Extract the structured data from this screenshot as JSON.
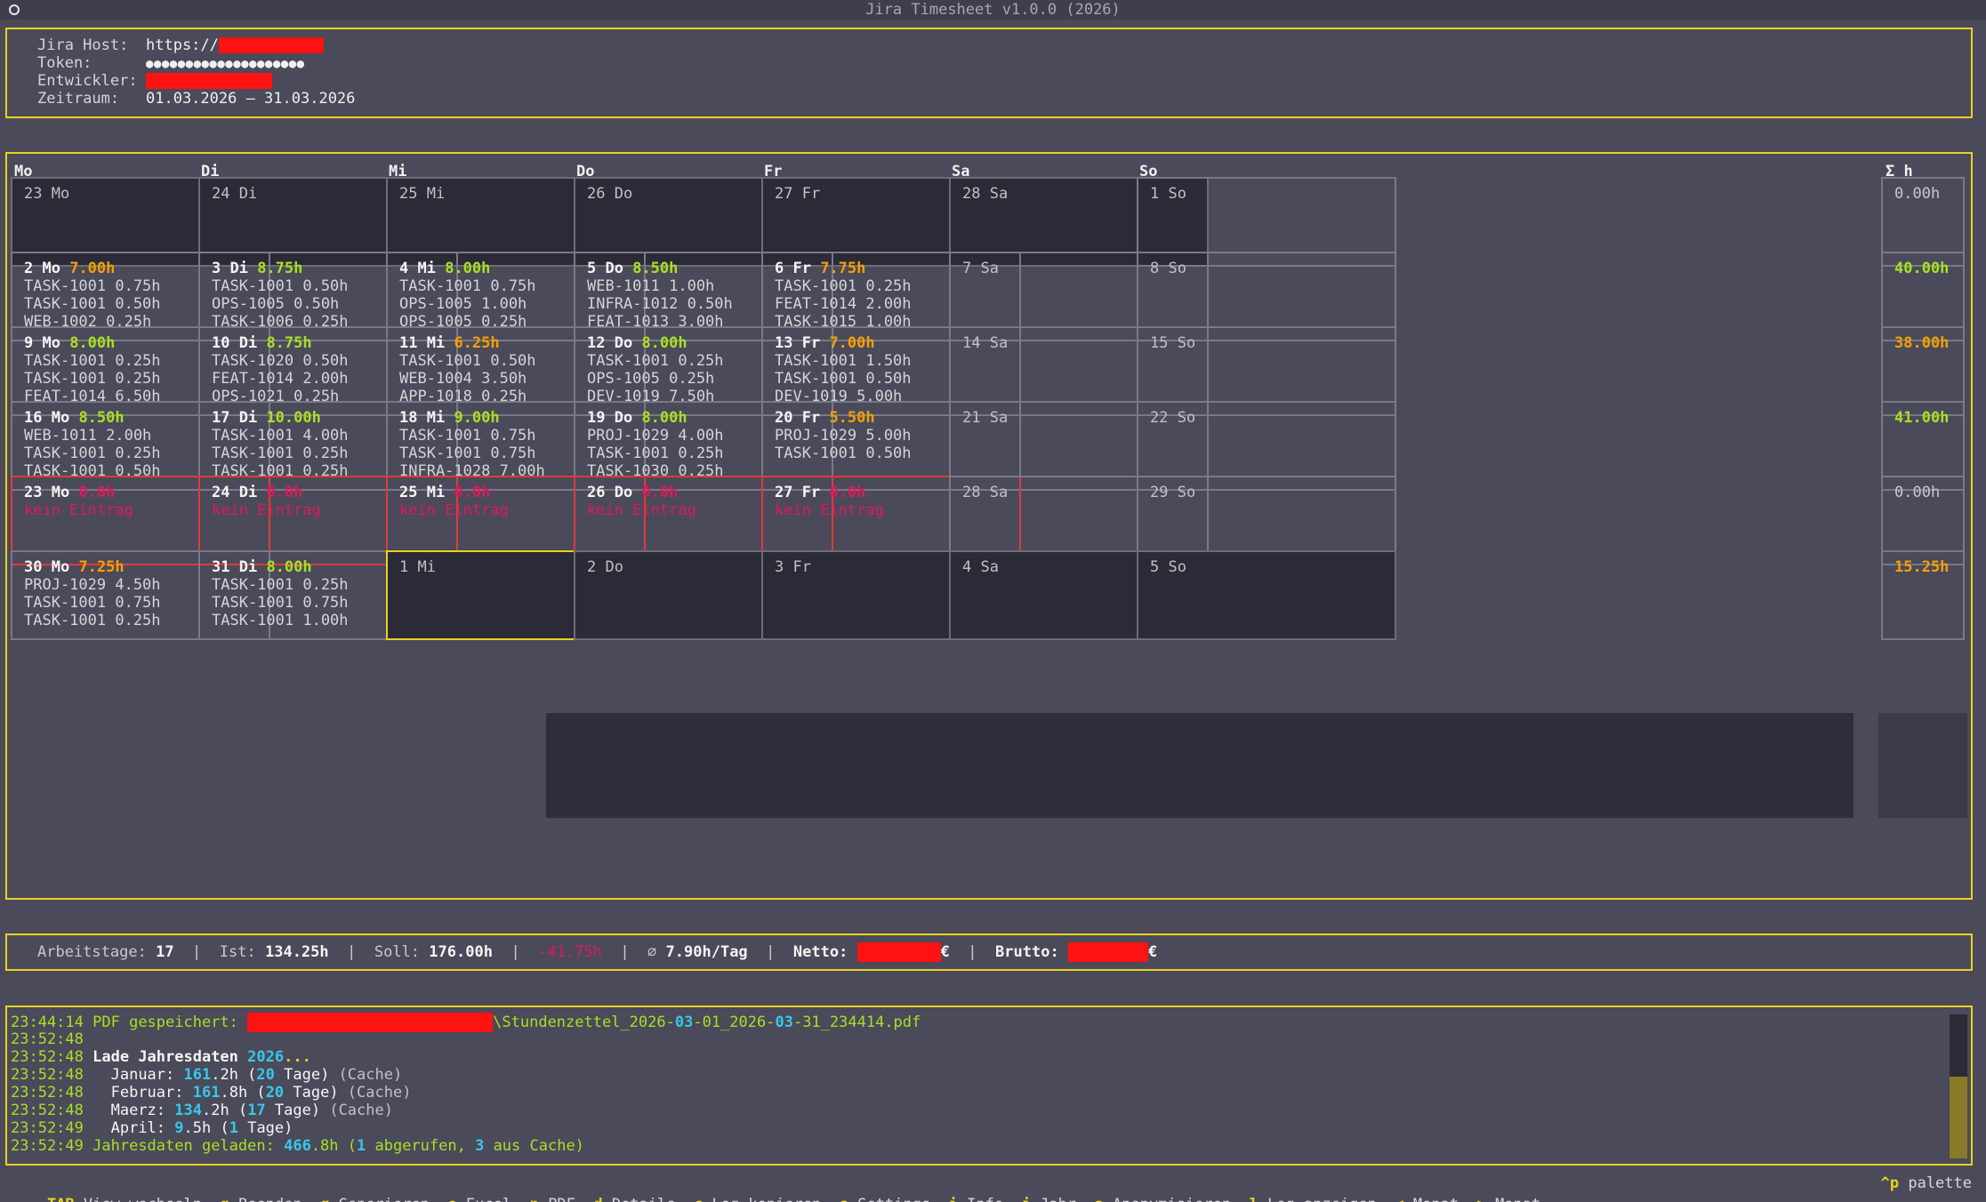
{
  "window": {
    "title": "Jira Timesheet v1.0.0 (2026)"
  },
  "header": {
    "host_label": "Jira Host:",
    "host_value": "https://",
    "token_label": "Token:",
    "token_value": "●●●●●●●●●●●●●●●●●●●●",
    "dev_label": "Entwickler:",
    "range_label": "Zeitraum:",
    "range_value": "01.03.2026 – 31.03.2026"
  },
  "calendar": {
    "day_headers": [
      "Mo",
      "Di",
      "Mi",
      "Do",
      "Fr",
      "Sa",
      "So"
    ],
    "sum_header": "Σ h",
    "weeks": [
      {
        "days": [
          {
            "label": "23 Mo"
          },
          {
            "label": "24 Di"
          },
          {
            "label": "25 Mi"
          },
          {
            "label": "26 Do"
          },
          {
            "label": "27 Fr"
          },
          {
            "label": "28 Sa"
          },
          {
            "label": "1 So"
          }
        ],
        "sum": "0.00h"
      },
      {
        "days": [
          {
            "label": "2 Mo",
            "hours": "7.00h",
            "entries": [
              "TASK-1001 0.75h",
              "TASK-1001 0.50h",
              "WEB-1002 0.25h"
            ]
          },
          {
            "label": "3 Di",
            "hours": "8.75h",
            "entries": [
              "TASK-1001 0.50h",
              "OPS-1005 0.50h",
              "TASK-1006 0.25h"
            ]
          },
          {
            "label": "4 Mi",
            "hours": "8.00h",
            "entries": [
              "TASK-1001 0.75h",
              "OPS-1005 1.00h",
              "OPS-1005 0.25h"
            ]
          },
          {
            "label": "5 Do",
            "hours": "8.50h",
            "entries": [
              "WEB-1011 1.00h",
              "INFRA-1012 0.50h",
              "FEAT-1013 3.00h"
            ]
          },
          {
            "label": "6 Fr",
            "hours": "7.75h",
            "entries": [
              "TASK-1001 0.25h",
              "FEAT-1014 2.00h",
              "TASK-1015 1.00h"
            ]
          },
          {
            "label": "7 Sa"
          },
          {
            "label": "8 So"
          }
        ],
        "sum": "40.00h"
      },
      {
        "days": [
          {
            "label": "9 Mo",
            "hours": "8.00h",
            "entries": [
              "TASK-1001 0.25h",
              "TASK-1001 0.25h",
              "FEAT-1014 6.50h"
            ]
          },
          {
            "label": "10 Di",
            "hours": "8.75h",
            "entries": [
              "TASK-1020 0.50h",
              "FEAT-1014 2.00h",
              "OPS-1021 0.25h"
            ]
          },
          {
            "label": "11 Mi",
            "hours": "6.25h",
            "entries": [
              "TASK-1001 0.50h",
              "WEB-1004 3.50h",
              "APP-1018 0.25h"
            ]
          },
          {
            "label": "12 Do",
            "hours": "8.00h",
            "entries": [
              "TASK-1001 0.25h",
              "OPS-1005 0.25h",
              "DEV-1019 7.50h"
            ]
          },
          {
            "label": "13 Fr",
            "hours": "7.00h",
            "entries": [
              "TASK-1001 1.50h",
              "TASK-1001 0.50h",
              "DEV-1019 5.00h"
            ]
          },
          {
            "label": "14 Sa"
          },
          {
            "label": "15 So"
          }
        ],
        "sum": "38.00h"
      },
      {
        "days": [
          {
            "label": "16 Mo",
            "hours": "8.50h",
            "entries": [
              "WEB-1011 2.00h",
              "TASK-1001 0.25h",
              "TASK-1001 0.50h"
            ]
          },
          {
            "label": "17 Di",
            "hours": "10.00h",
            "entries": [
              "TASK-1001 4.00h",
              "TASK-1001 0.25h",
              "TASK-1001 0.25h"
            ]
          },
          {
            "label": "18 Mi",
            "hours": "9.00h",
            "entries": [
              "TASK-1001 0.75h",
              "TASK-1001 0.75h",
              "INFRA-1028 7.00h"
            ]
          },
          {
            "label": "19 Do",
            "hours": "8.00h",
            "entries": [
              "PROJ-1029 4.00h",
              "TASK-1001 0.25h",
              "TASK-1030 0.25h"
            ]
          },
          {
            "label": "20 Fr",
            "hours": "5.50h",
            "entries": [
              "PROJ-1029 5.00h",
              "TASK-1001 0.50h"
            ]
          },
          {
            "label": "21 Sa"
          },
          {
            "label": "22 So"
          }
        ],
        "sum": "41.00h"
      },
      {
        "days": [
          {
            "label": "23 Mo",
            "hours": "0.0h",
            "missing": "kein Eintrag"
          },
          {
            "label": "24 Di",
            "hours": "0.0h",
            "missing": "kein Eintrag"
          },
          {
            "label": "25 Mi",
            "hours": "0.0h",
            "missing": "kein Eintrag"
          },
          {
            "label": "26 Do",
            "hours": "0.0h",
            "missing": "kein Eintrag"
          },
          {
            "label": "27 Fr",
            "hours": "0.0h",
            "missing": "kein Eintrag"
          },
          {
            "label": "28 Sa"
          },
          {
            "label": "29 So"
          }
        ],
        "sum": "0.00h"
      },
      {
        "days": [
          {
            "label": "30 Mo",
            "hours": "7.25h",
            "entries": [
              "PROJ-1029 4.50h",
              "TASK-1001 0.75h",
              "TASK-1001 0.25h"
            ]
          },
          {
            "label": "31 Di",
            "hours": "8.00h",
            "entries": [
              "TASK-1001 0.25h",
              "TASK-1001 0.75h",
              "TASK-1001 1.00h"
            ]
          },
          {
            "label": "1 Mi"
          },
          {
            "label": "2 Do"
          },
          {
            "label": "3 Fr"
          },
          {
            "label": "4 Sa"
          },
          {
            "label": "5 So"
          }
        ],
        "sum": "15.25h"
      }
    ]
  },
  "summary": {
    "workdays_label": "Arbeitstage:",
    "workdays": "17",
    "ist_label": "Ist:",
    "ist": "134.25h",
    "soll_label": "Soll:",
    "soll": "176.00h",
    "diff": "-41.75h",
    "avg_label": "∅",
    "avg": "7.90h/Tag",
    "netto_label": "Netto:",
    "brutto_label": "Brutto:",
    "currency": "€",
    "separator": "|"
  },
  "log": {
    "lines": [
      {
        "ts": "23:44:14",
        "text": "PDF gespeichert:",
        "file_a": "\\Stundenzettel_2026-",
        "file_b": "03",
        "file_c": "-01_2026-",
        "file_d": "03",
        "file_e": "-31_234414.pdf"
      },
      {
        "ts": "23:52:48"
      },
      {
        "ts": "23:52:48",
        "text": "Lade Jahresdaten",
        "year": "2026",
        "suffix": "..."
      },
      {
        "ts": "23:52:48",
        "month": "Januar:",
        "hours_a": "161",
        "hours_b": ".2h (",
        "days": "20",
        "days_suffix": " Tage)",
        "src": " (Cache)"
      },
      {
        "ts": "23:52:48",
        "month": "Februar:",
        "hours_a": "161",
        "hours_b": ".8h (",
        "days": "20",
        "days_suffix": " Tage)",
        "src": " (Cache)"
      },
      {
        "ts": "23:52:48",
        "month": "Maerz:",
        "hours_a": "134",
        "hours_b": ".2h (",
        "days": "17",
        "days_suffix": " Tage)",
        "src": " (Cache)"
      },
      {
        "ts": "23:52:49",
        "month": "April:",
        "hours_a": "9",
        "hours_b": ".5h (",
        "days": "1",
        "days_suffix": " Tage)",
        "src": ""
      },
      {
        "ts": "23:52:49",
        "text": "Jahresdaten geladen:",
        "total": "466",
        "total_suffix": ".8h (",
        "fetched": "1",
        "fetched_suffix": " abgerufen, ",
        "cached": "3",
        "cached_suffix": " aus Cache)"
      }
    ]
  },
  "footer": {
    "keys": [
      {
        "key": "TAB",
        "label": "View wechseln"
      },
      {
        "key": "q",
        "label": "Beenden"
      },
      {
        "key": "g",
        "label": "Generieren"
      },
      {
        "key": "e",
        "label": "Excel"
      },
      {
        "key": "p",
        "label": "PDF"
      },
      {
        "key": "d",
        "label": "Details"
      },
      {
        "key": "c",
        "label": "Log kopieren"
      },
      {
        "key": "s",
        "label": "Settings"
      },
      {
        "key": "i",
        "label": "Info"
      },
      {
        "key": "j",
        "label": "Jahr"
      },
      {
        "key": "a",
        "label": "Anonymisieren"
      },
      {
        "key": "l",
        "label": "Log anzeigen"
      },
      {
        "key": "<",
        "label": "Monat"
      },
      {
        "key": ">",
        "label": "Monat"
      }
    ],
    "palette_key": "^p",
    "palette_label": "palette"
  },
  "colors": {
    "accent": "#e8d21c",
    "ok_hours": "#a8e022",
    "low_hours": "#f5a000",
    "missing": "#e0185a",
    "redacted": "#ff1212"
  }
}
